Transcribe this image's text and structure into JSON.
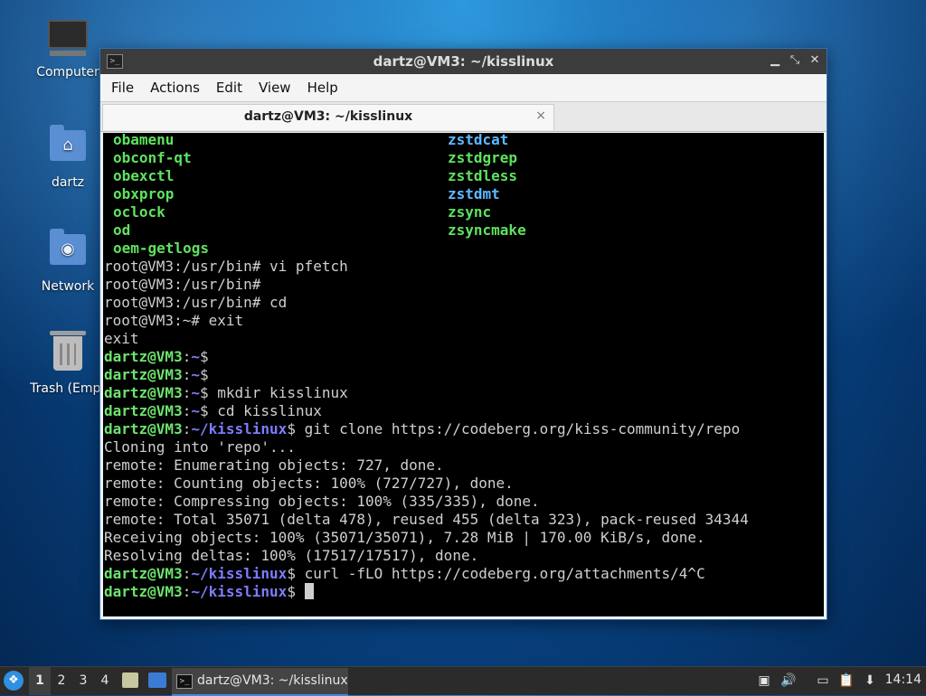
{
  "desktop": {
    "icons": [
      {
        "label": "Computer"
      },
      {
        "label": "dartz"
      },
      {
        "label": "Network"
      },
      {
        "label": "Trash (Empt"
      }
    ]
  },
  "window": {
    "title": "dartz@VM3: ~/kisslinux",
    "menu": [
      "File",
      "Actions",
      "Edit",
      "View",
      "Help"
    ],
    "tab_label": "dartz@VM3: ~/kisslinux",
    "tab_close": "×"
  },
  "terminal": {
    "listing": [
      [
        "obamenu",
        "zstdcat"
      ],
      [
        "obconf-qt",
        "zstdgrep"
      ],
      [
        "obexctl",
        "zstdless"
      ],
      [
        "obxprop",
        "zstdmt"
      ],
      [
        "oclock",
        "zsync"
      ],
      [
        "od",
        "zsyncmake"
      ],
      [
        "oem-getlogs",
        ""
      ]
    ],
    "plain_lines": [
      "root@VM3:/usr/bin# vi pfetch",
      "root@VM3:/usr/bin#",
      "root@VM3:/usr/bin# cd",
      "root@VM3:~# exit",
      "exit"
    ],
    "prompt_user": "dartz@VM3",
    "prompt_sep": ":",
    "prompt_home": "~",
    "prompt_repo": "~/kisslinux",
    "prompt_end": "$",
    "cmd_mkdir": " mkdir kisslinux",
    "cmd_cd": " cd kisslinux",
    "cmd_clone": " git clone https://codeberg.org/kiss-community/repo",
    "output": [
      "Cloning into 'repo'...",
      "remote: Enumerating objects: 727, done.",
      "remote: Counting objects: 100% (727/727), done.",
      "remote: Compressing objects: 100% (335/335), done.",
      "remote: Total 35071 (delta 478), reused 455 (delta 323), pack-reused 34344",
      "Receiving objects: 100% (35071/35071), 7.28 MiB | 170.00 KiB/s, done.",
      "Resolving deltas: 100% (17517/17517), done."
    ],
    "cmd_curl": " curl -fLO https://codeberg.org/attachments/4^C"
  },
  "taskbar": {
    "workspaces": [
      "1",
      "2",
      "3",
      "4"
    ],
    "active_workspace": "1",
    "task_label": "dartz@VM3: ~/kisslinux",
    "clock": "14:14"
  },
  "colors": {
    "green": "#5fe25f",
    "cyan": "#5fb8ff",
    "prompt_path": "#7d7dff",
    "window_border": "#2d6fb8"
  }
}
